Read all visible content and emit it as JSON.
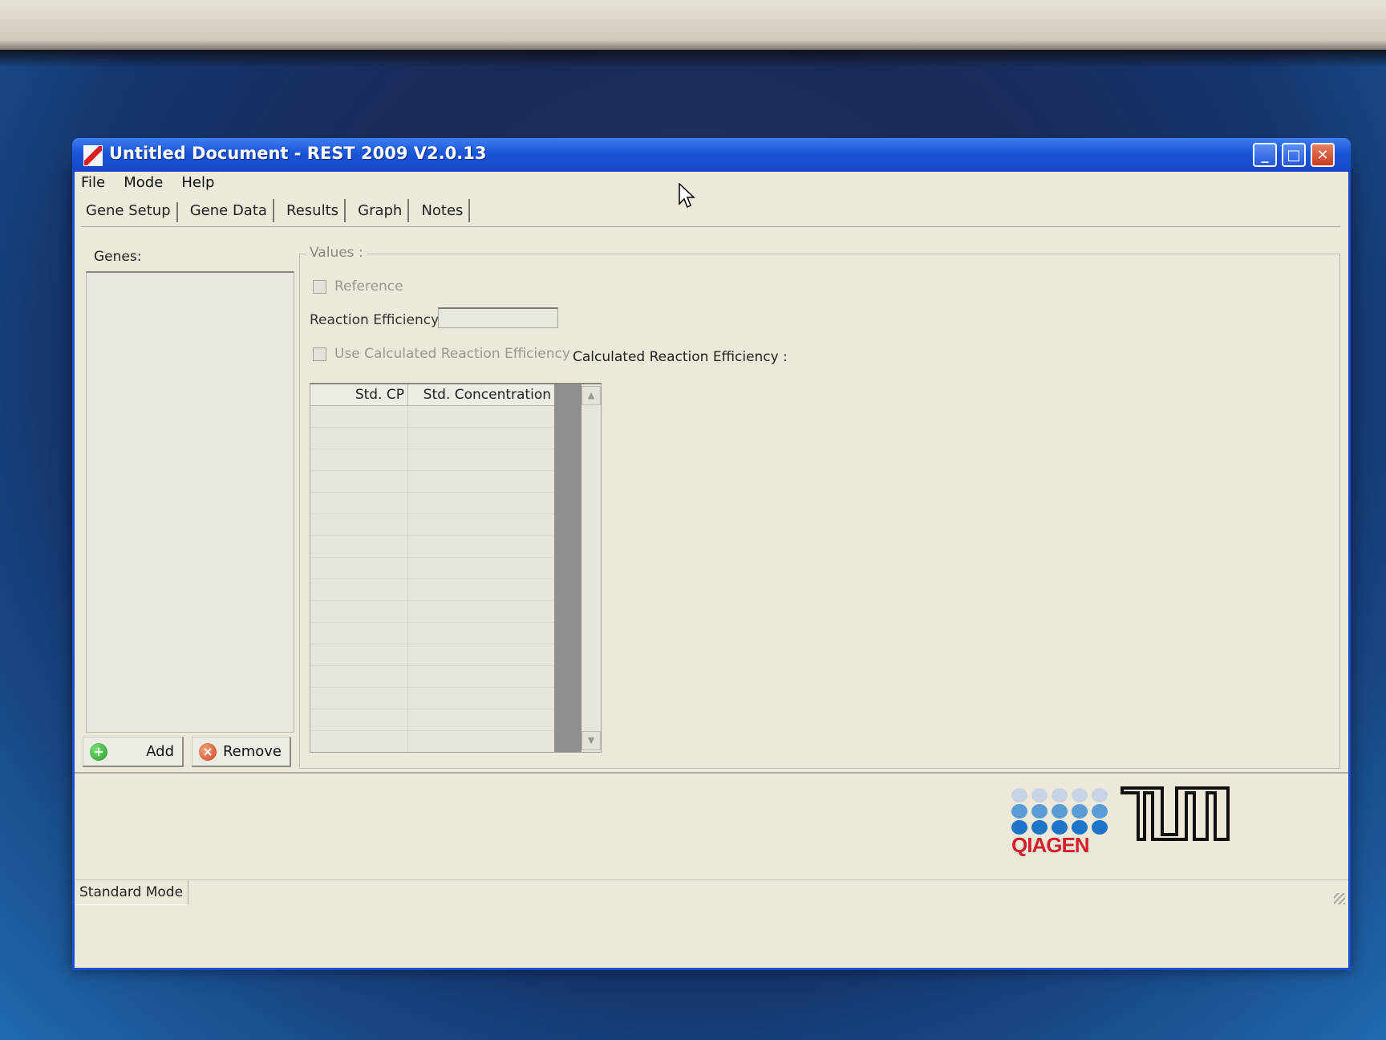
{
  "window": {
    "title": "Untitled Document - REST 2009 V2.0.13",
    "controls": {
      "minimize": "_",
      "maximize": "□",
      "close": "✕"
    }
  },
  "menu": [
    "File",
    "Mode",
    "Help"
  ],
  "tabs": [
    "Gene Setup",
    "Gene Data",
    "Results",
    "Graph",
    "Notes"
  ],
  "active_tab": "Gene Setup",
  "genes": {
    "label": "Genes:",
    "add_label": "Add",
    "remove_label": "Remove"
  },
  "values": {
    "legend": "Values :",
    "reference_label": "Reference",
    "reaction_efficiency_label": "Reaction Efficiency :",
    "reaction_efficiency_value": "",
    "use_calculated_label": "Use Calculated Reaction Efficiency",
    "calculated_label": "Calculated Reaction Efficiency :"
  },
  "std_table": {
    "columns": [
      "Std. CP",
      "Std. Concentration"
    ]
  },
  "logos": {
    "qiagen_text": "QIAGEN",
    "qiagen_colors": {
      "top": "#c9d3e6",
      "mid": "#5b9bd6",
      "bottom": "#1e74c8",
      "text": "#d4202e"
    }
  },
  "status": {
    "mode": "Standard Mode"
  }
}
